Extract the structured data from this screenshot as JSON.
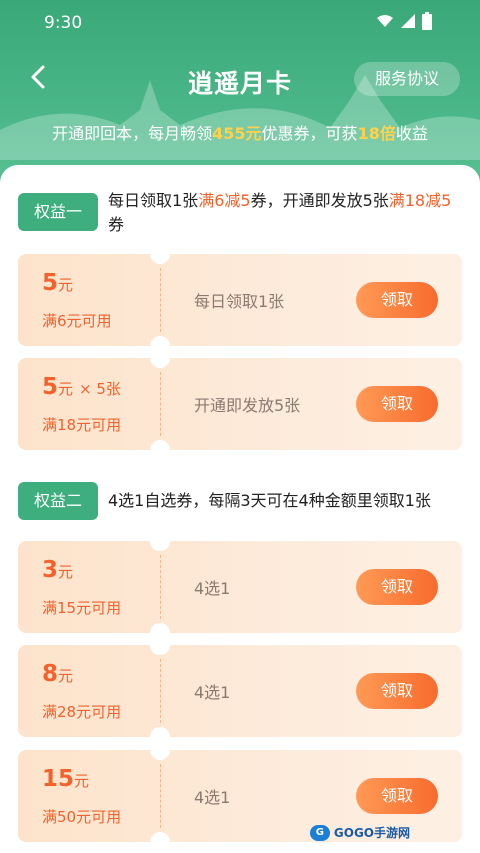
{
  "status": {
    "time": "9:30"
  },
  "header": {
    "title": "逍遥月卡",
    "service_label": "服务协议",
    "subtitle_pre": "开通即回本，每月畅领",
    "subtitle_amount": "455元",
    "subtitle_mid": "优惠券，可获",
    "subtitle_multiple": "18倍",
    "subtitle_post": "收益"
  },
  "benefit1": {
    "tag": "权益一",
    "desc_a": "每日领取1张",
    "desc_b": "满6减5",
    "desc_c": "券，开通即发放5张",
    "desc_d": "满18减5",
    "desc_e": "券"
  },
  "benefit2": {
    "tag": "权益二",
    "desc": "4选1自选券，每隔3天可在4种金额里领取1张"
  },
  "coupons": [
    {
      "amount": "5",
      "unit": "元",
      "multiplier": "",
      "condition": "满6元可用",
      "info": "每日领取1张",
      "button": "领取"
    },
    {
      "amount": "5",
      "unit": "元",
      "multiplier": "× 5张",
      "condition": "满18元可用",
      "info": "开通即发放5张",
      "button": "领取"
    },
    {
      "amount": "3",
      "unit": "元",
      "multiplier": "",
      "condition": "满15元可用",
      "info": "4选1",
      "button": "领取"
    },
    {
      "amount": "8",
      "unit": "元",
      "multiplier": "",
      "condition": "满28元可用",
      "info": "4选1",
      "button": "领取"
    },
    {
      "amount": "15",
      "unit": "元",
      "multiplier": "",
      "condition": "满50元可用",
      "info": "4选1",
      "button": "领取"
    }
  ],
  "watermark": {
    "logo": "G",
    "text": "GOGO手游网"
  },
  "colors": {
    "green": "#3fae7f",
    "orange": "#f1622c",
    "highlight": "#ffd24a"
  },
  "icons": {
    "back": "chevron-left-icon",
    "wifi": "wifi-icon",
    "signal": "signal-icon",
    "battery": "battery-icon"
  }
}
